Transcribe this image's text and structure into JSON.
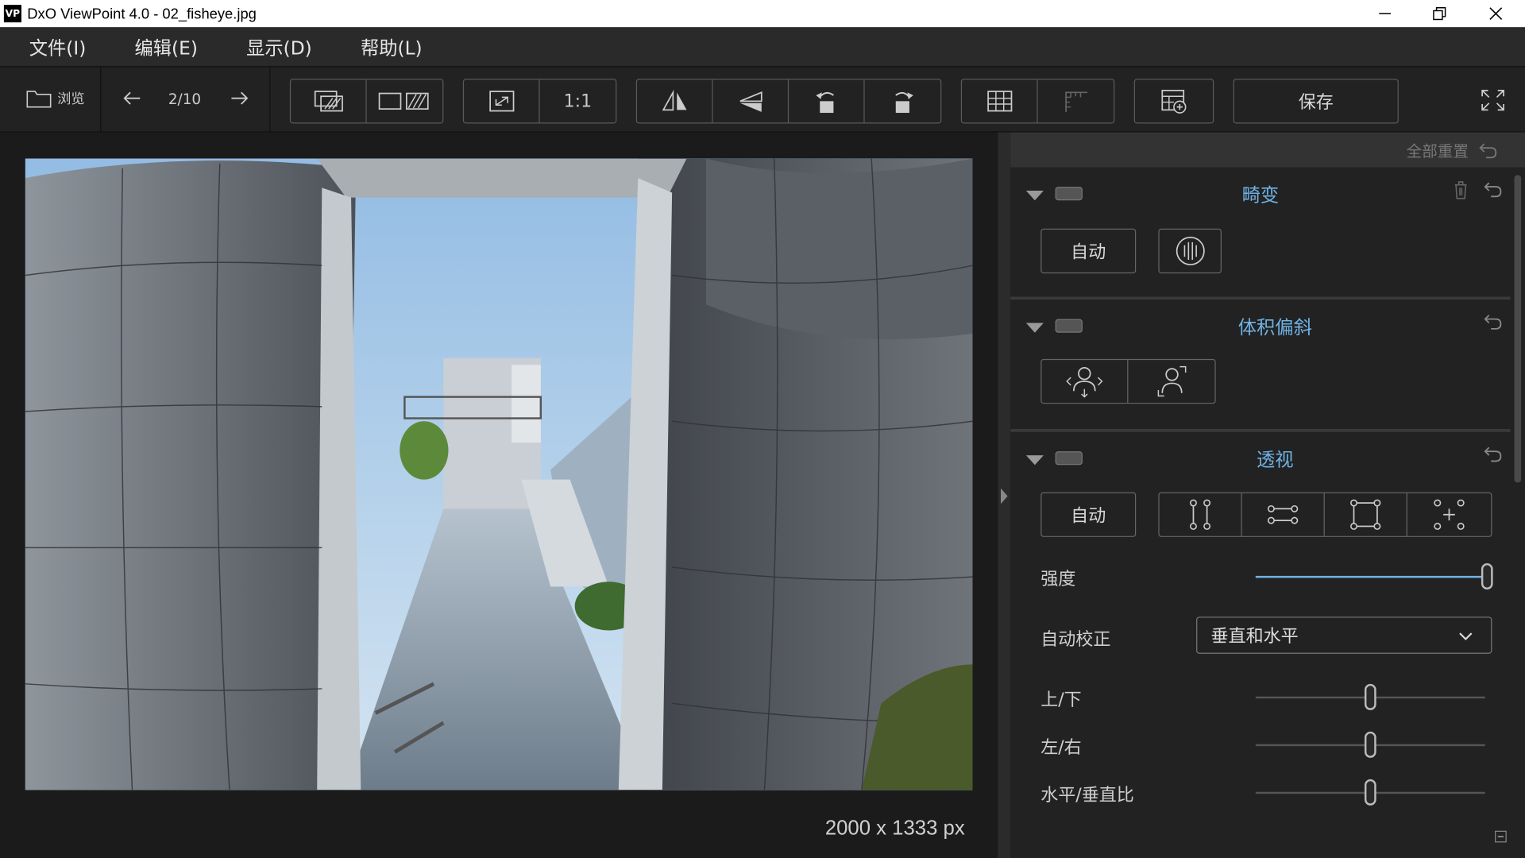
{
  "window": {
    "app_icon": "VP",
    "title": "DxO ViewPoint 4.0 - 02_fisheye.jpg"
  },
  "menu": [
    "文件(I)",
    "编辑(E)",
    "显示(D)",
    "帮助(L)"
  ],
  "toolbar": {
    "browse_label": "浏览",
    "page_counter": "2/10",
    "zoom_one_label": "1:1",
    "save_label": "保存"
  },
  "viewer": {
    "image_dimensions": "2000 x 1333 px"
  },
  "panel": {
    "reset_all_label": "全部重置",
    "distortion": {
      "title": "畸变",
      "auto_label": "自动"
    },
    "volume": {
      "title": "体积偏斜"
    },
    "perspective": {
      "title": "透视",
      "auto_label": "自动",
      "strength_label": "强度",
      "strength_value": 1.0,
      "auto_correct_label": "自动校正",
      "auto_correct_value": "垂直和水平",
      "updown_label": "上/下",
      "updown_value": 0.5,
      "leftright_label": "左/右",
      "leftright_value": 0.5,
      "ratio_label": "水平/垂直比",
      "ratio_value": 0.5
    }
  },
  "colors": {
    "accent": "#6fb3e6",
    "background": "#1b1b1b",
    "panel": "#222222"
  }
}
